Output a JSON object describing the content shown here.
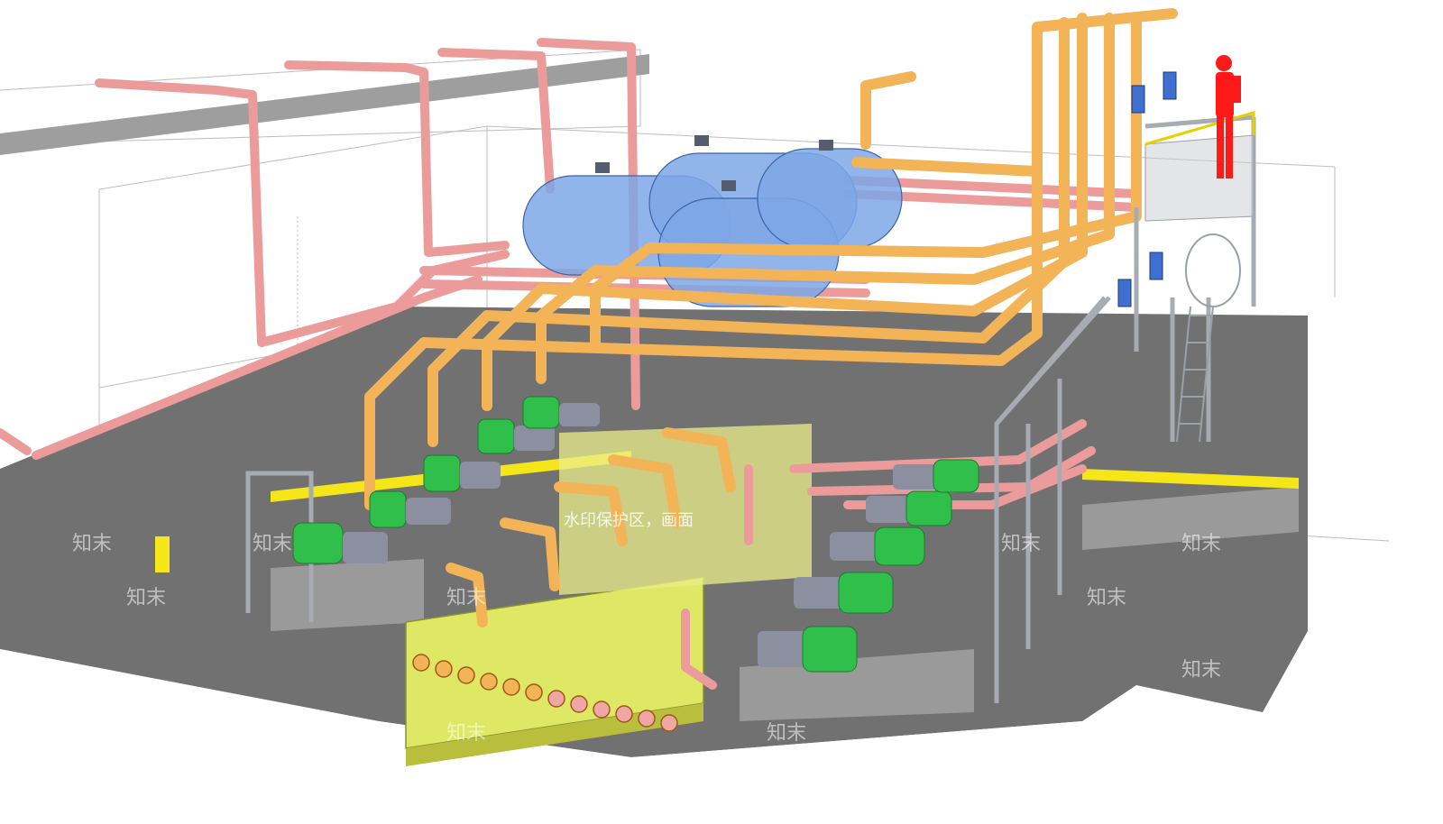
{
  "palette": {
    "sky": "#ffffff",
    "floor": "#6e6e6e",
    "floor_dark": "#555555",
    "slab": "#9a9a9a",
    "pit": "#e6ec6a",
    "pink_pipe": "#f0a6a4",
    "orange_pipe": "#f3b357",
    "tank": "#7ea7e6",
    "pump_motor": "#2fbf4a",
    "pump_body": "#8c8fa0",
    "steel": "#b9bcc2",
    "operator": "#ff1a1a",
    "curb": "#f5e61a"
  },
  "watermark": {
    "banner_text": "水印保护区，画面",
    "brand_text": "知末",
    "tiles": [
      "知末",
      "知末",
      "知末",
      "知末",
      "知末",
      "知末",
      "知末",
      "知末",
      "知末",
      "知末",
      "知末",
      "知末"
    ]
  },
  "components": {
    "tanks_count": 4,
    "pumps_left_count": 5,
    "pumps_right_count": 5,
    "outlet_flanges_count": 12,
    "operator": "person-figure"
  }
}
